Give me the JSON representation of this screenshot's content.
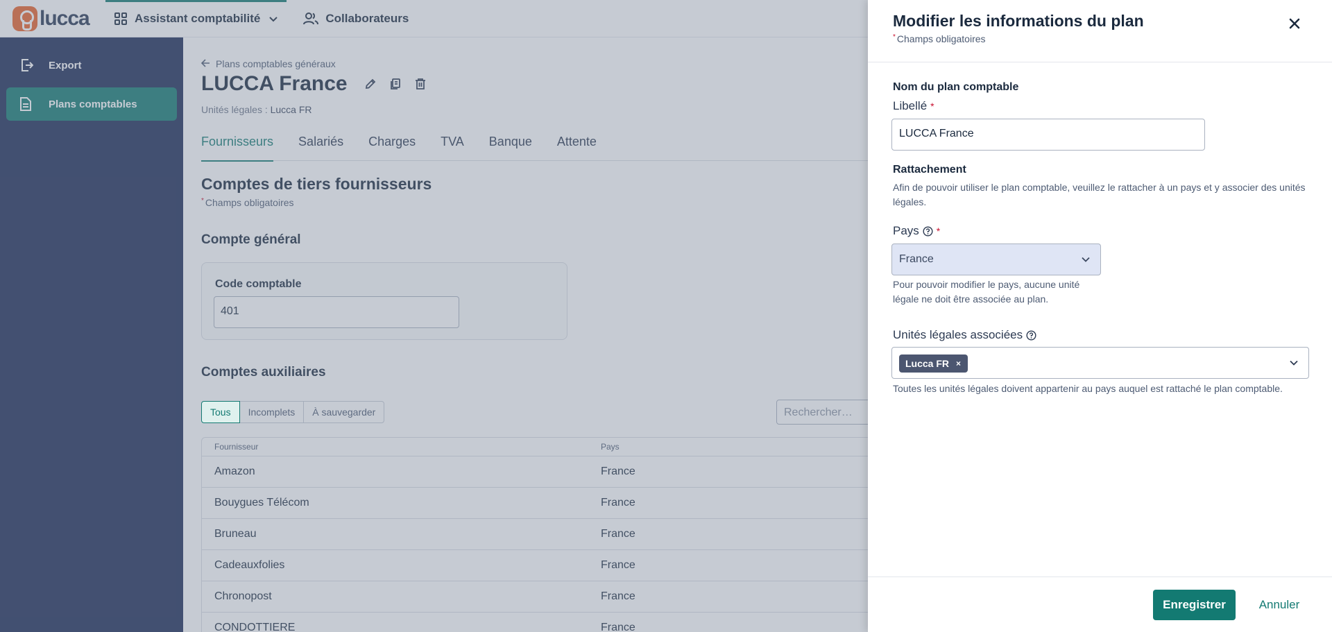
{
  "app": {
    "logo_text": "lucca",
    "nav": [
      {
        "label": "Assistant comptabilité",
        "icon": "grid-icon",
        "active": true
      },
      {
        "label": "Collaborateurs",
        "icon": "users-icon",
        "active": false
      }
    ]
  },
  "sidebar": {
    "items": [
      {
        "label": "Export",
        "icon": "export-icon",
        "active": false
      },
      {
        "label": "Plans comptables",
        "icon": "document-icon",
        "active": true
      }
    ]
  },
  "main": {
    "back_label": "Plans comptables généraux",
    "title": "LUCCA France",
    "legal_units_prefix": "Unités légales :",
    "legal_units_value": "Lucca FR",
    "tabs": [
      "Fournisseurs",
      "Salariés",
      "Charges",
      "TVA",
      "Banque",
      "Attente"
    ],
    "section_title": "Comptes de tiers fournisseurs",
    "required_note": "Champs obligatoires",
    "general_account": {
      "title": "Compte général",
      "code_label": "Code comptable",
      "code_value": "401"
    },
    "auxiliary": {
      "title": "Comptes auxiliaires",
      "filters": [
        "Tous",
        "Incomplets",
        "À sauvegarder"
      ],
      "search_placeholder": "Rechercher…",
      "columns": [
        "Fournisseur",
        "Pays"
      ],
      "rows": [
        {
          "name": "Amazon",
          "country": "France"
        },
        {
          "name": "Bouygues Télécom",
          "country": "France"
        },
        {
          "name": "Bruneau",
          "country": "France"
        },
        {
          "name": "Cadeauxfolies",
          "country": "France"
        },
        {
          "name": "Chronopost",
          "country": "France"
        },
        {
          "name": "CONDOTTIERE",
          "country": "France"
        }
      ]
    }
  },
  "panel": {
    "title": "Modifier les informations du plan",
    "required_note": "Champs obligatoires",
    "name_section": "Nom du plan comptable",
    "label_field": {
      "label": "Libellé",
      "value": "LUCCA France"
    },
    "attachment_section": "Rattachement",
    "attachment_desc": "Afin de pouvoir utiliser le plan comptable, veuillez le rattacher à un pays et y associer des unités légales.",
    "country_field": {
      "label": "Pays",
      "value": "France",
      "hint": "Pour pouvoir modifier le pays, aucune unité légale ne doit être associée au plan."
    },
    "legal_units_field": {
      "label": "Unités légales associées",
      "chips": [
        "Lucca FR"
      ],
      "hint": "Toutes les unités légales doivent appartenir au pays auquel est rattaché le plan comptable."
    },
    "save_label": "Enregistrer",
    "cancel_label": "Annuler"
  },
  "colors": {
    "primary": "#137a72",
    "sidebar": "#1d2b56",
    "logo": "#e8622a",
    "required": "#c8102e"
  }
}
